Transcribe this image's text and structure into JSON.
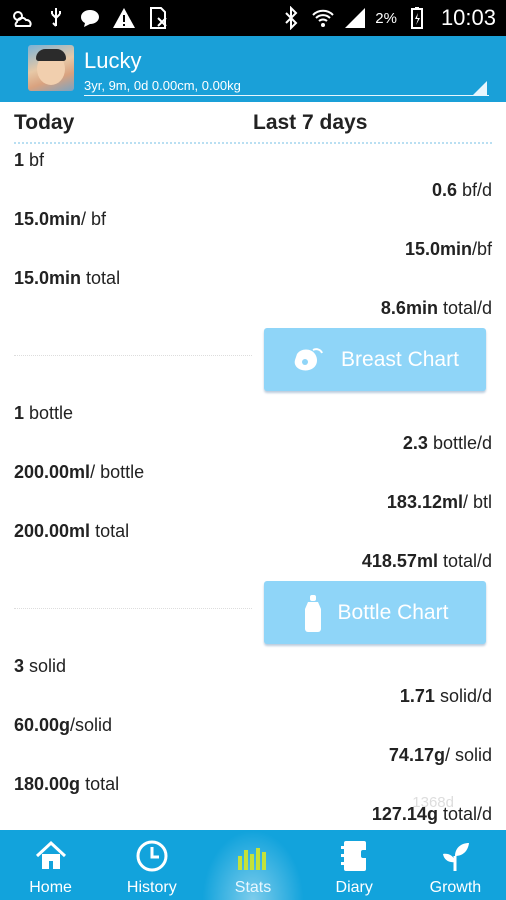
{
  "status_bar": {
    "battery_pct": "2%",
    "time": "10:03",
    "icons": [
      "weather-icon",
      "usb-icon",
      "chat-icon",
      "warning-icon",
      "no-sim-icon",
      "bluetooth-icon",
      "wifi-icon",
      "signal-icon",
      "battery-icon"
    ]
  },
  "header": {
    "name": "Lucky",
    "details": "3yr, 9m, 0d 0.00cm, 0.00kg"
  },
  "columns": {
    "today": "Today",
    "last7": "Last 7 days"
  },
  "breast": {
    "today_count": {
      "v": "1",
      "u": " bf"
    },
    "avg_count": {
      "v": "0.6",
      "u": " bf/d"
    },
    "today_duration": {
      "v": "15.0min",
      "u": "/ bf"
    },
    "avg_duration": {
      "v": "15.0min",
      "u": "/bf"
    },
    "today_total": {
      "v": "15.0min",
      "u": " total"
    },
    "avg_total": {
      "v": "8.6min",
      "u": " total/d"
    },
    "chart_label": "Breast Chart"
  },
  "bottle": {
    "today_count": {
      "v": "1",
      "u": " bottle"
    },
    "avg_count": {
      "v": "2.3",
      "u": " bottle/d"
    },
    "today_amount": {
      "v": "200.00ml",
      "u": "/ bottle"
    },
    "avg_amount": {
      "v": "183.12ml",
      "u": "/ btl"
    },
    "today_total": {
      "v": "200.00ml",
      "u": " total"
    },
    "avg_total": {
      "v": "418.57ml",
      "u": " total/d"
    },
    "chart_label": "Bottle Chart"
  },
  "solid": {
    "today_count": {
      "v": "3",
      "u": " solid"
    },
    "avg_count": {
      "v": "1.71",
      "u": " solid/d"
    },
    "today_amount": {
      "v": "60.00g",
      "u": "/solid"
    },
    "avg_amount": {
      "v": "74.17g",
      "u": "/ solid"
    },
    "today_total": {
      "v": "180.00g",
      "u": " total"
    },
    "avg_total": {
      "v": "127.14g",
      "u": " total/d"
    }
  },
  "watermark": "1368d",
  "nav": [
    {
      "label": "Home",
      "icon": "home-icon"
    },
    {
      "label": "History",
      "icon": "history-icon"
    },
    {
      "label": "Stats",
      "icon": "stats-icon",
      "active": true
    },
    {
      "label": "Diary",
      "icon": "diary-icon"
    },
    {
      "label": "Growth",
      "icon": "growth-icon"
    }
  ],
  "colors": {
    "header": "#1aa0d8",
    "nav": "#12a3dc",
    "chart_button": "#8fd5f8"
  }
}
